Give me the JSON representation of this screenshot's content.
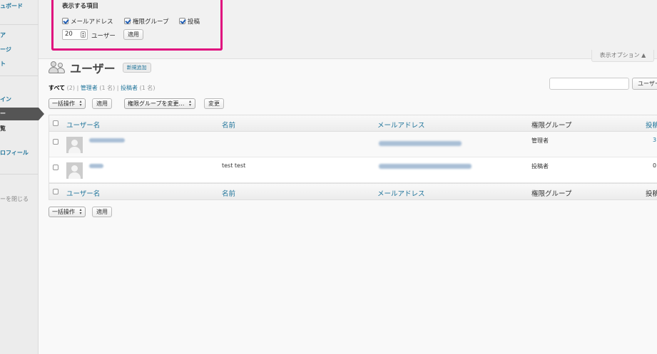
{
  "sidebar": {
    "items": [
      {
        "label": "ュボード"
      },
      {
        "label": "ア"
      },
      {
        "label": "ージ"
      },
      {
        "label": "ト"
      },
      {
        "label": "イン"
      },
      {
        "label": "ー"
      },
      {
        "label": "覧"
      },
      {
        "label": "ロフィール"
      },
      {
        "label": "ーを閉じる"
      }
    ]
  },
  "screen_options": {
    "title": "表示する項目",
    "columns": [
      {
        "label": "メールアドレス",
        "checked": true
      },
      {
        "label": "権限グループ",
        "checked": true
      },
      {
        "label": "投稿",
        "checked": true
      }
    ],
    "per_page_value": "20",
    "per_page_label": "ユーザー",
    "apply_label": "適用",
    "tab_label": "表示オプション ▲"
  },
  "header": {
    "title": "ユーザー",
    "add_new_label": "新規追加"
  },
  "filters": {
    "all_label": "すべて",
    "all_count": "(2)",
    "admin_label": "管理者",
    "admin_count": "(1 名)",
    "author_label": "投稿者",
    "author_count": "(1 名)",
    "separator": "|"
  },
  "search": {
    "button_label": "ユーザー検索"
  },
  "bulk_actions": {
    "select_label": "一括操作",
    "apply_label": "適用",
    "role_select_label": "権限グループを変更…",
    "change_label": "変更"
  },
  "table": {
    "columns": {
      "username": "ユーザー名",
      "name": "名前",
      "email": "メールアドレス",
      "role": "権限グループ",
      "posts": "投稿"
    },
    "rows": [
      {
        "name": "",
        "role": "管理者",
        "posts": "3"
      },
      {
        "name": "test test",
        "role": "投稿者",
        "posts": "0"
      }
    ]
  },
  "colors": {
    "link": "#21759b",
    "highlight_border": "#e0107e",
    "sidebar_current": "#555555"
  }
}
